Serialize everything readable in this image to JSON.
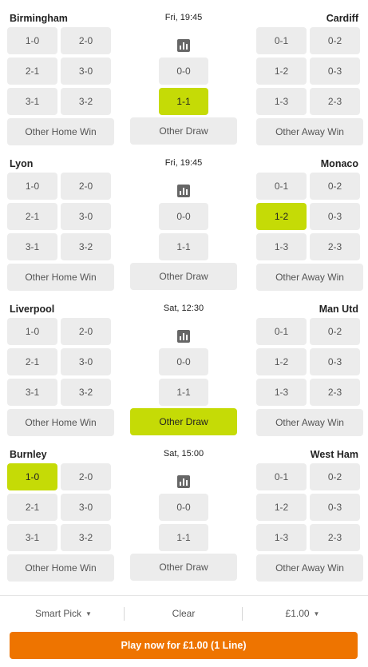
{
  "matches": [
    {
      "home": "Birmingham",
      "away": "Cardiff",
      "time": "Fri, 19:45",
      "home_scores": [
        "1-0",
        "2-0",
        "2-1",
        "3-0",
        "3-1",
        "3-2"
      ],
      "draw_scores": [
        "0-0",
        "1-1"
      ],
      "away_scores": [
        "0-1",
        "0-2",
        "1-2",
        "0-3",
        "1-3",
        "2-3"
      ],
      "other_home": "Other Home Win",
      "other_draw": "Other Draw",
      "other_away": "Other Away Win",
      "selected": "draw-1"
    },
    {
      "home": "Lyon",
      "away": "Monaco",
      "time": "Fri, 19:45",
      "home_scores": [
        "1-0",
        "2-0",
        "2-1",
        "3-0",
        "3-1",
        "3-2"
      ],
      "draw_scores": [
        "0-0",
        "1-1"
      ],
      "away_scores": [
        "0-1",
        "0-2",
        "1-2",
        "0-3",
        "1-3",
        "2-3"
      ],
      "other_home": "Other Home Win",
      "other_draw": "Other Draw",
      "other_away": "Other Away Win",
      "selected": "away-2"
    },
    {
      "home": "Liverpool",
      "away": "Man Utd",
      "time": "Sat, 12:30",
      "home_scores": [
        "1-0",
        "2-0",
        "2-1",
        "3-0",
        "3-1",
        "3-2"
      ],
      "draw_scores": [
        "0-0",
        "1-1"
      ],
      "away_scores": [
        "0-1",
        "0-2",
        "1-2",
        "0-3",
        "1-3",
        "2-3"
      ],
      "other_home": "Other Home Win",
      "other_draw": "Other Draw",
      "other_away": "Other Away Win",
      "selected": "draw-other"
    },
    {
      "home": "Burnley",
      "away": "West Ham",
      "time": "Sat, 15:00",
      "home_scores": [
        "1-0",
        "2-0",
        "2-1",
        "3-0",
        "3-1",
        "3-2"
      ],
      "draw_scores": [
        "0-0",
        "1-1"
      ],
      "away_scores": [
        "0-1",
        "0-2",
        "1-2",
        "0-3",
        "1-3",
        "2-3"
      ],
      "other_home": "Other Home Win",
      "other_draw": "Other Draw",
      "other_away": "Other Away Win",
      "selected": "home-0"
    }
  ],
  "footer": {
    "smart_pick": "Smart Pick",
    "clear": "Clear",
    "stake": "£1.00",
    "play": "Play now for £1.00 (1 Line)"
  },
  "colors": {
    "selected": "#c5db06",
    "cta": "#ee7400",
    "cell": "#ececec"
  },
  "icons": {
    "stats": "bar-chart-icon",
    "dropdown": "chevron-down-icon"
  }
}
